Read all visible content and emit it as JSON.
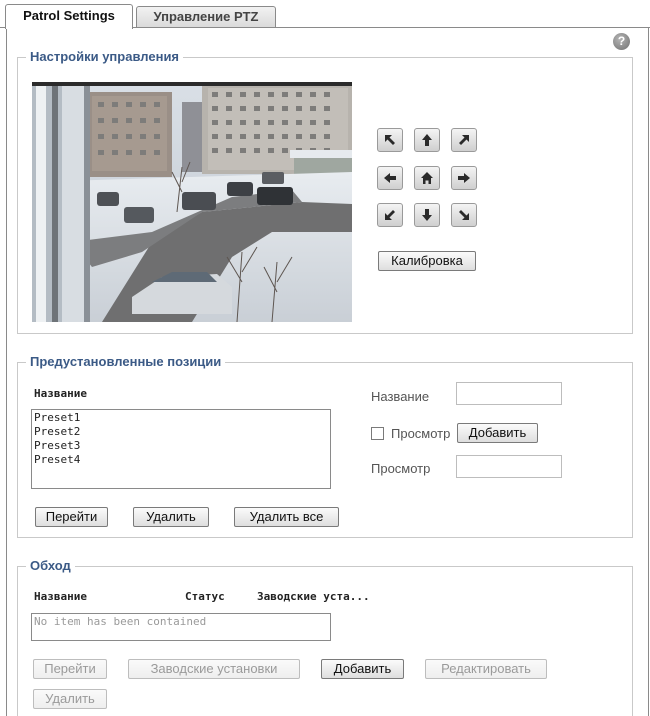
{
  "tabs": [
    {
      "label": "Patrol Settings",
      "active": true
    },
    {
      "label": "Управление PTZ",
      "active": false
    }
  ],
  "help_icon": "?",
  "control": {
    "legend": "Настройки управления",
    "arrows": [
      "up-left-arrow-icon",
      "up-arrow-icon",
      "up-right-arrow-icon",
      "left-arrow-icon",
      "home-icon",
      "right-arrow-icon",
      "down-left-arrow-icon",
      "down-arrow-icon",
      "down-right-arrow-icon"
    ],
    "calibrate_label": "Калибровка"
  },
  "presets": {
    "legend": "Предустановленные позиции",
    "list_header": "Название",
    "items": [
      "Preset1",
      "Preset2",
      "Preset3",
      "Preset4"
    ],
    "name_label": "Название",
    "name_value": "",
    "preview_checkbox_label": "Просмотр",
    "preview_checked": false,
    "add_label": "Добавить",
    "preview_label": "Просмотр",
    "preview_value": "",
    "go_label": "Перейти",
    "delete_label": "Удалить",
    "delete_all_label": "Удалить все"
  },
  "patrol": {
    "legend": "Обход",
    "columns": [
      "Название",
      "Статус",
      "Заводские уста..."
    ],
    "empty_text": "No item has been contained",
    "go_label": "Перейти",
    "defaults_label": "Заводские установки",
    "add_label": "Добавить",
    "edit_label": "Редактировать",
    "delete_label": "Удалить"
  },
  "colors": {
    "legend": "#3b5a86",
    "border": "#c9c9c9",
    "disabled_text": "#9a9a9a"
  }
}
